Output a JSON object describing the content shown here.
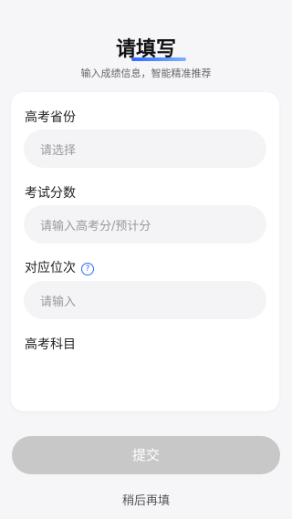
{
  "header": {
    "title": "请填写",
    "subtitle": "输入成绩信息，智能精准推荐"
  },
  "form": {
    "province": {
      "label": "高考省份",
      "placeholder": "请选择"
    },
    "score": {
      "label": "考试分数",
      "placeholder": "请输入高考分/预计分"
    },
    "rank": {
      "label": "对应位次",
      "help_icon": "?",
      "placeholder": "请输入"
    },
    "subjects": {
      "label": "高考科目"
    }
  },
  "actions": {
    "submit_label": "提交",
    "later_label": "稍后再填"
  },
  "colors": {
    "accent": "#2c6bff",
    "submit_disabled": "#c8c8c8",
    "background": "#f6f6f8"
  }
}
